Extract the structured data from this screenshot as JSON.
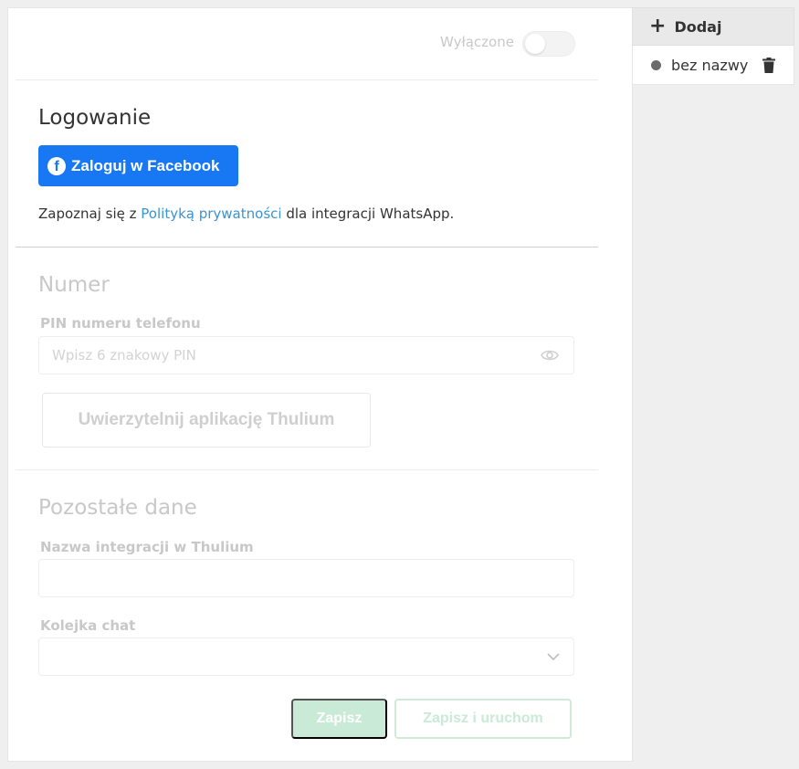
{
  "toggle": {
    "label": "Wyłączone",
    "enabled": false
  },
  "login": {
    "title": "Logowanie",
    "facebook_button": "Zaloguj w Facebook",
    "privacy_prefix": "Zapoznaj się z ",
    "privacy_link": "Polityką prywatności",
    "privacy_suffix": " dla integracji WhatsApp."
  },
  "number": {
    "title": "Numer",
    "pin_label": "PIN numeru telefonu",
    "pin_placeholder": "Wpisz 6 znakowy PIN",
    "auth_button": "Uwierzytelnij aplikację Thulium"
  },
  "other": {
    "title": "Pozostałe dane",
    "integration_name_label": "Nazwa integracji w Thulium",
    "integration_name_value": "",
    "queue_label": "Kolejka chat",
    "queue_value": ""
  },
  "actions": {
    "save": "Zapisz",
    "save_and_run": "Zapisz i uruchom"
  },
  "sidebar": {
    "add_label": "Dodaj",
    "items": [
      {
        "label": "bez nazwy"
      }
    ]
  },
  "colors": {
    "facebook": "#1877f2",
    "link": "#3a93d4",
    "save_disabled": "#c9ead7"
  }
}
